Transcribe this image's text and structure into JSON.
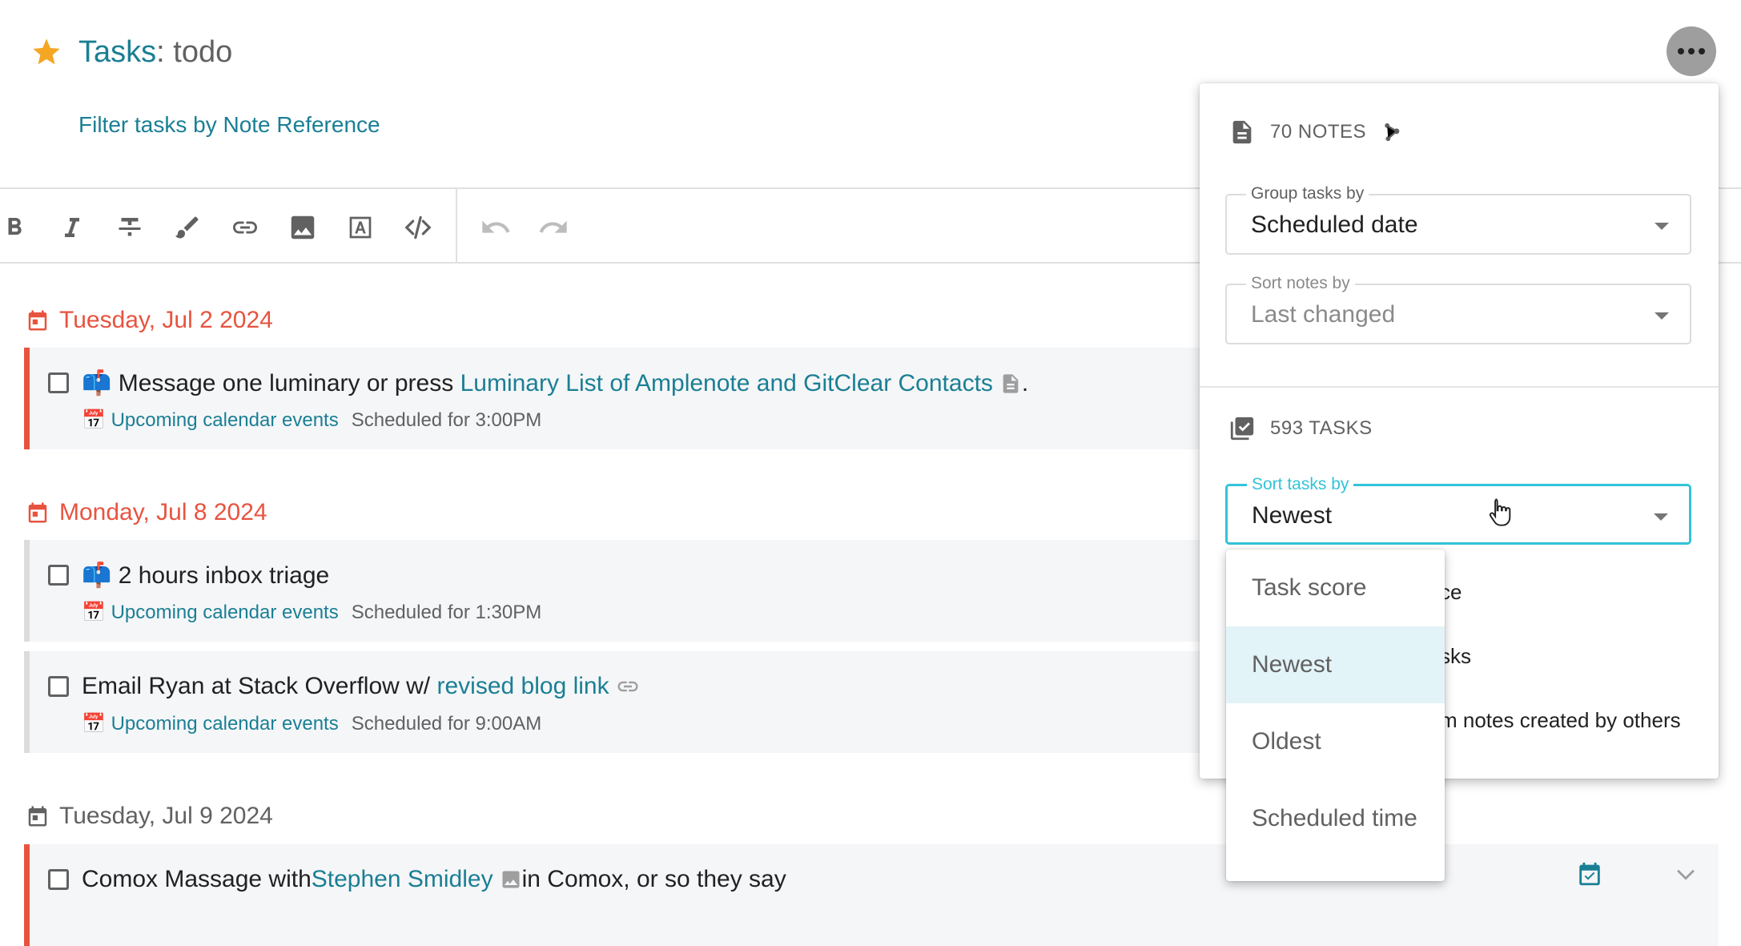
{
  "header": {
    "title_main": "Tasks",
    "title_sep": ": ",
    "title_sub": "todo",
    "filter_link": "Filter tasks by Note Reference"
  },
  "toolbar": {
    "buttons": [
      "bold-icon",
      "italic-icon",
      "strikethrough-icon",
      "brush-icon",
      "link-icon",
      "image-icon",
      "text-box-icon",
      "code-icon",
      "undo-icon",
      "redo-icon"
    ]
  },
  "groups": [
    {
      "date": "Tuesday, Jul 2 2024",
      "color": "#e8533f",
      "tasks": [
        {
          "emoji": "📫",
          "text_before": "Message one luminary or press ",
          "link": "Luminary List of Amplenote and GitClear Contacts",
          "text_after": ".",
          "calendar_emoji": "📅",
          "source": "Upcoming calendar events",
          "scheduled": "Scheduled for 3:00PM"
        }
      ]
    },
    {
      "date": "Monday, Jul 8 2024",
      "color": "#e8533f",
      "tasks": [
        {
          "emoji": "📫",
          "text_before": "2 hours inbox triage",
          "calendar_emoji": "📅",
          "source": "Upcoming calendar events",
          "scheduled": "Scheduled for 1:30PM"
        },
        {
          "text_before": "Email Ryan at Stack Overflow w/ ",
          "link": "revised blog link",
          "calendar_emoji": "📅",
          "source": "Upcoming calendar events",
          "scheduled": "Scheduled for 9:00AM"
        }
      ]
    },
    {
      "date": "Tuesday, Jul 9 2024",
      "color": "#616161",
      "tasks": [
        {
          "text_before": "Comox Massage with ",
          "link": "Stephen Smidley",
          "text_after": " in Comox, or so they say"
        }
      ]
    }
  ],
  "panel": {
    "notes_count": "70 NOTES",
    "group_label": "Group tasks by",
    "group_value": "Scheduled date",
    "sort_notes_label": "Sort notes by",
    "sort_notes_value": "Last changed",
    "tasks_count": "593 TASKS",
    "sort_tasks_label": "Sort tasks by",
    "sort_tasks_value": "Newest",
    "partial_1": "ce",
    "partial_2": "sks",
    "partial_3": "m notes created by others"
  },
  "menu": {
    "options": [
      "Task score",
      "Newest",
      "Oldest",
      "Scheduled time"
    ],
    "selected": "Newest"
  },
  "colors": {
    "accent": "#1a7f94",
    "overdue": "#e8533f",
    "focus": "#33c3d9",
    "star": "#f5a623"
  }
}
